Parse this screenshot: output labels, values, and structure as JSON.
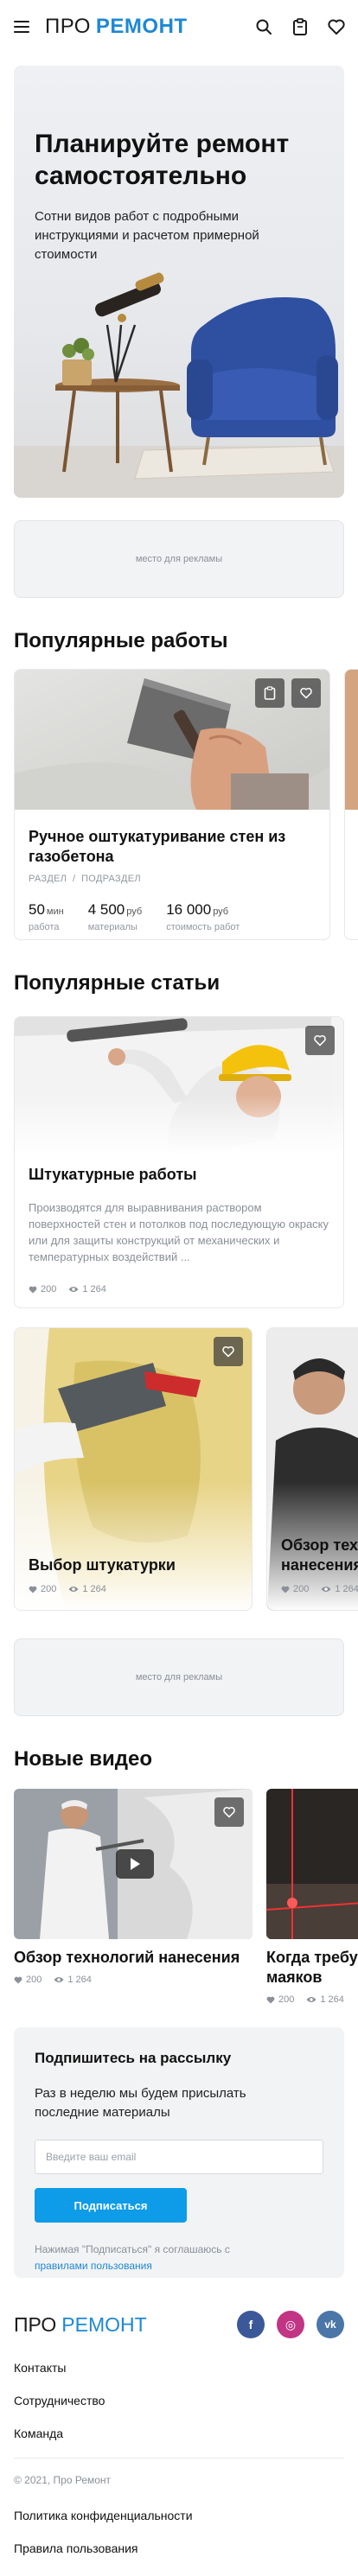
{
  "header": {
    "logo_part1": "ПРО",
    "logo_part2": "РЕМОНТ",
    "icons": [
      "menu-icon",
      "search-icon",
      "clipboard-icon",
      "heart-icon"
    ]
  },
  "hero": {
    "title": "Планируйте ремонт самостоятельно",
    "subtitle": "Сотни видов работ с подробными инструкциями и расчетом примерной стоимости"
  },
  "ads": {
    "label": "место для рекламы"
  },
  "works": {
    "title": "Популярные работы",
    "items": [
      {
        "title": "Ручное оштукатуривание стен из газобетона",
        "section": "РАЗДЕЛ",
        "sep": "/",
        "subsection": "ПОДРАЗДЕЛ",
        "stats": [
          {
            "value": "50",
            "unit": "мин",
            "label": "работа"
          },
          {
            "value": "4 500",
            "unit": "руб",
            "label": "материалы"
          },
          {
            "value": "16 000",
            "unit": "руб",
            "label": "стоимость работ"
          }
        ]
      }
    ]
  },
  "articles": {
    "title": "Популярные статьи",
    "featured": {
      "title": "Штукатурные работы",
      "text": "Производятся для выравнивания раствором поверхностей стен и потолков под последующую окраску или для защиты конструкций от механических и температурных воздействий ...",
      "likes": "200",
      "views": "1 264"
    },
    "items": [
      {
        "title": "Выбор штукатурки",
        "likes": "200",
        "views": "1 264"
      },
      {
        "title": "Обзор технологий нанесения",
        "likes": "200",
        "views": "1 264"
      }
    ]
  },
  "videos": {
    "title": "Новые видео",
    "items": [
      {
        "title": "Обзор технологий нанесения",
        "likes": "200",
        "views": "1 264"
      },
      {
        "title": "Когда требуется установка маяков",
        "likes": "200",
        "views": "1 264"
      }
    ]
  },
  "newsletter": {
    "title": "Подпишитесь на рассылку",
    "text": "Раз в неделю мы будем присылать последние материалы",
    "placeholder": "Введите ваш email",
    "button": "Подписаться",
    "terms_prefix": "Нажимая \"Подписаться\" я соглашаюсь с",
    "terms_link": "правилами пользования"
  },
  "footer": {
    "logo_part1": "ПРО",
    "logo_part2": "РЕМОНТ",
    "social": [
      {
        "name": "facebook",
        "glyph": "f",
        "color": "#3b5998"
      },
      {
        "name": "instagram",
        "glyph": "◎",
        "color": "#c13584"
      },
      {
        "name": "vk",
        "glyph": "vk",
        "color": "#4a76a8"
      }
    ],
    "links": [
      "Контакты",
      "Сотрудничество",
      "Команда"
    ],
    "copyright": "© 2021, Про Ремонт",
    "legal": [
      "Политика конфиденциальности",
      "Правила пользования"
    ]
  },
  "colors": {
    "accent": "#1e88d6",
    "button": "#0e9be8"
  }
}
